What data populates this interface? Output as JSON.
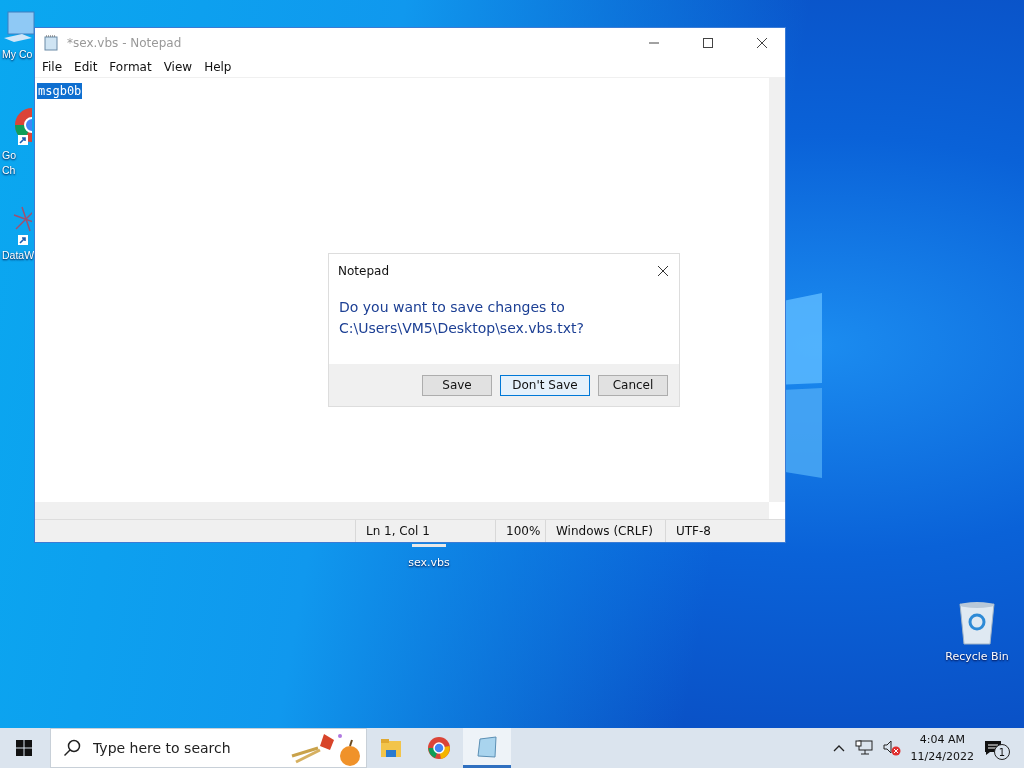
{
  "desktop_icons": [
    {
      "kind": "computer",
      "label": "My Co"
    },
    {
      "kind": "chrome",
      "label": "Go\nCh"
    },
    {
      "kind": "app",
      "label": "DataW"
    },
    {
      "kind": "file",
      "label": "sex.vbs"
    },
    {
      "kind": "recycle",
      "label": "Recycle Bin"
    }
  ],
  "window": {
    "title": "*sex.vbs - Notepad",
    "menu": [
      "File",
      "Edit",
      "Format",
      "View",
      "Help"
    ],
    "text": "msgb0b",
    "text_selected": true,
    "status_bar": [
      "Ln 1, Col 1",
      "100%",
      "Windows (CRLF)",
      "UTF-8"
    ]
  },
  "dialog": {
    "title": "Notepad",
    "message": "Do you want to save changes to\nC:\\Users\\VM5\\Desktop\\sex.vbs.txt?",
    "buttons": [
      {
        "label": "Save",
        "focused": false
      },
      {
        "label": "Don't Save",
        "focused": true
      },
      {
        "label": "Cancel",
        "focused": false
      }
    ]
  },
  "taskbar": {
    "search_placeholder": "Type here to search",
    "apps": [
      {
        "kind": "folder",
        "active": false
      },
      {
        "kind": "chrome",
        "active": false
      },
      {
        "kind": "notepad",
        "active": true
      }
    ],
    "time": "4:04 AM",
    "date": "11/24/2022",
    "notification_count": "1"
  }
}
